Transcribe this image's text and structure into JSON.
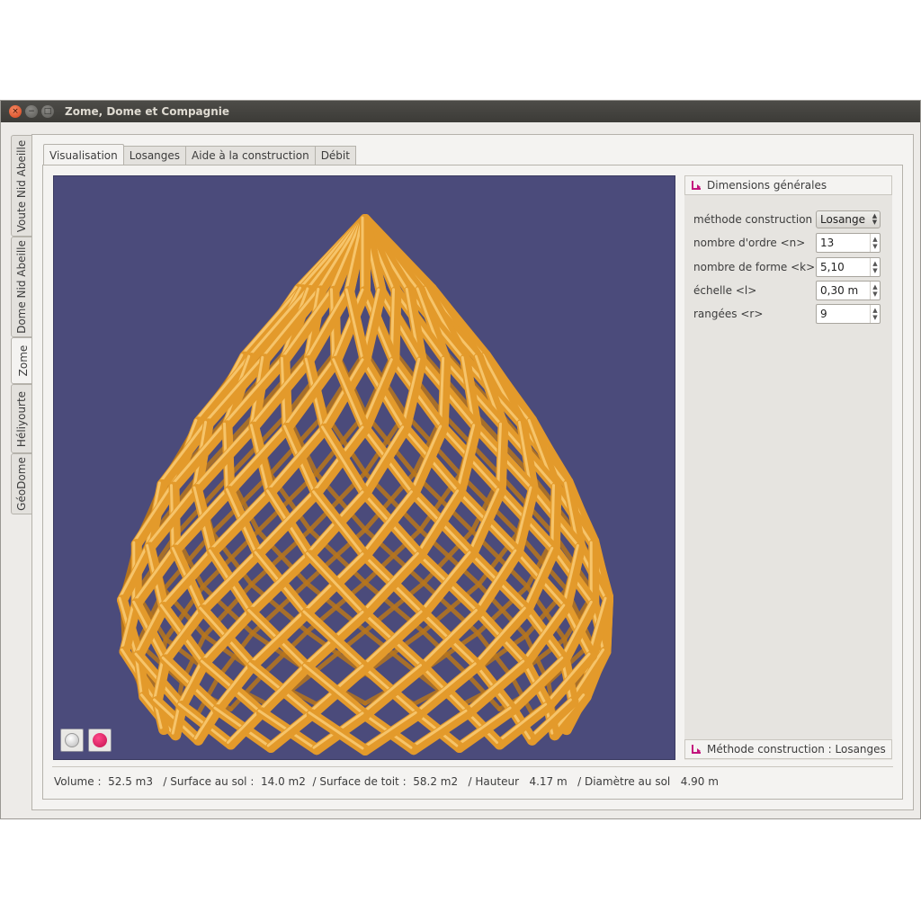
{
  "window": {
    "title": "Zome, Dome et Compagnie",
    "close_glyph": "×",
    "min_glyph": "−",
    "max_glyph": "□"
  },
  "side_tabs": [
    {
      "label": "Voute Nid Abeille",
      "active": false
    },
    {
      "label": "Dome Nid Abeille",
      "active": false
    },
    {
      "label": "Zome",
      "active": true
    },
    {
      "label": "Héliyourte",
      "active": false
    },
    {
      "label": "GéoDome",
      "active": false
    }
  ],
  "top_tabs": [
    {
      "label": "Visualisation",
      "active": true
    },
    {
      "label": "Losanges",
      "active": false
    },
    {
      "label": "Aide à la construction",
      "active": false
    },
    {
      "label": "Débit",
      "active": false
    }
  ],
  "viewport": {
    "background": "#4b4b7b",
    "structure_color": "#e39a2b",
    "buttons": [
      {
        "icon": "grey-sphere-icon",
        "color": "#c8c8c8"
      },
      {
        "icon": "record-dot-icon",
        "color": "#d4145a"
      }
    ]
  },
  "panel": {
    "group_title": "Dimensions générales",
    "properties": [
      {
        "label": "méthode construction",
        "value": "Losange",
        "kind": "combo"
      },
      {
        "label": "nombre d'ordre <n>",
        "value": "13",
        "kind": "spin"
      },
      {
        "label": "nombre de forme <k>",
        "value": "5,10",
        "kind": "spin"
      },
      {
        "label": "échelle <l>",
        "value": "0,30 m",
        "kind": "spin"
      },
      {
        "label": "rangées <r>",
        "value": "9",
        "kind": "spin"
      }
    ],
    "footer_label": "Méthode construction",
    "footer_value": " : Losanges",
    "accent": "#c3157d"
  },
  "status": {
    "text": "Volume :  52.5 m3   / Surface au sol :  14.0 m2  / Surface de toit :  58.2 m2   / Hauteur   4.17 m   / Diamètre au sol   4.90 m"
  }
}
